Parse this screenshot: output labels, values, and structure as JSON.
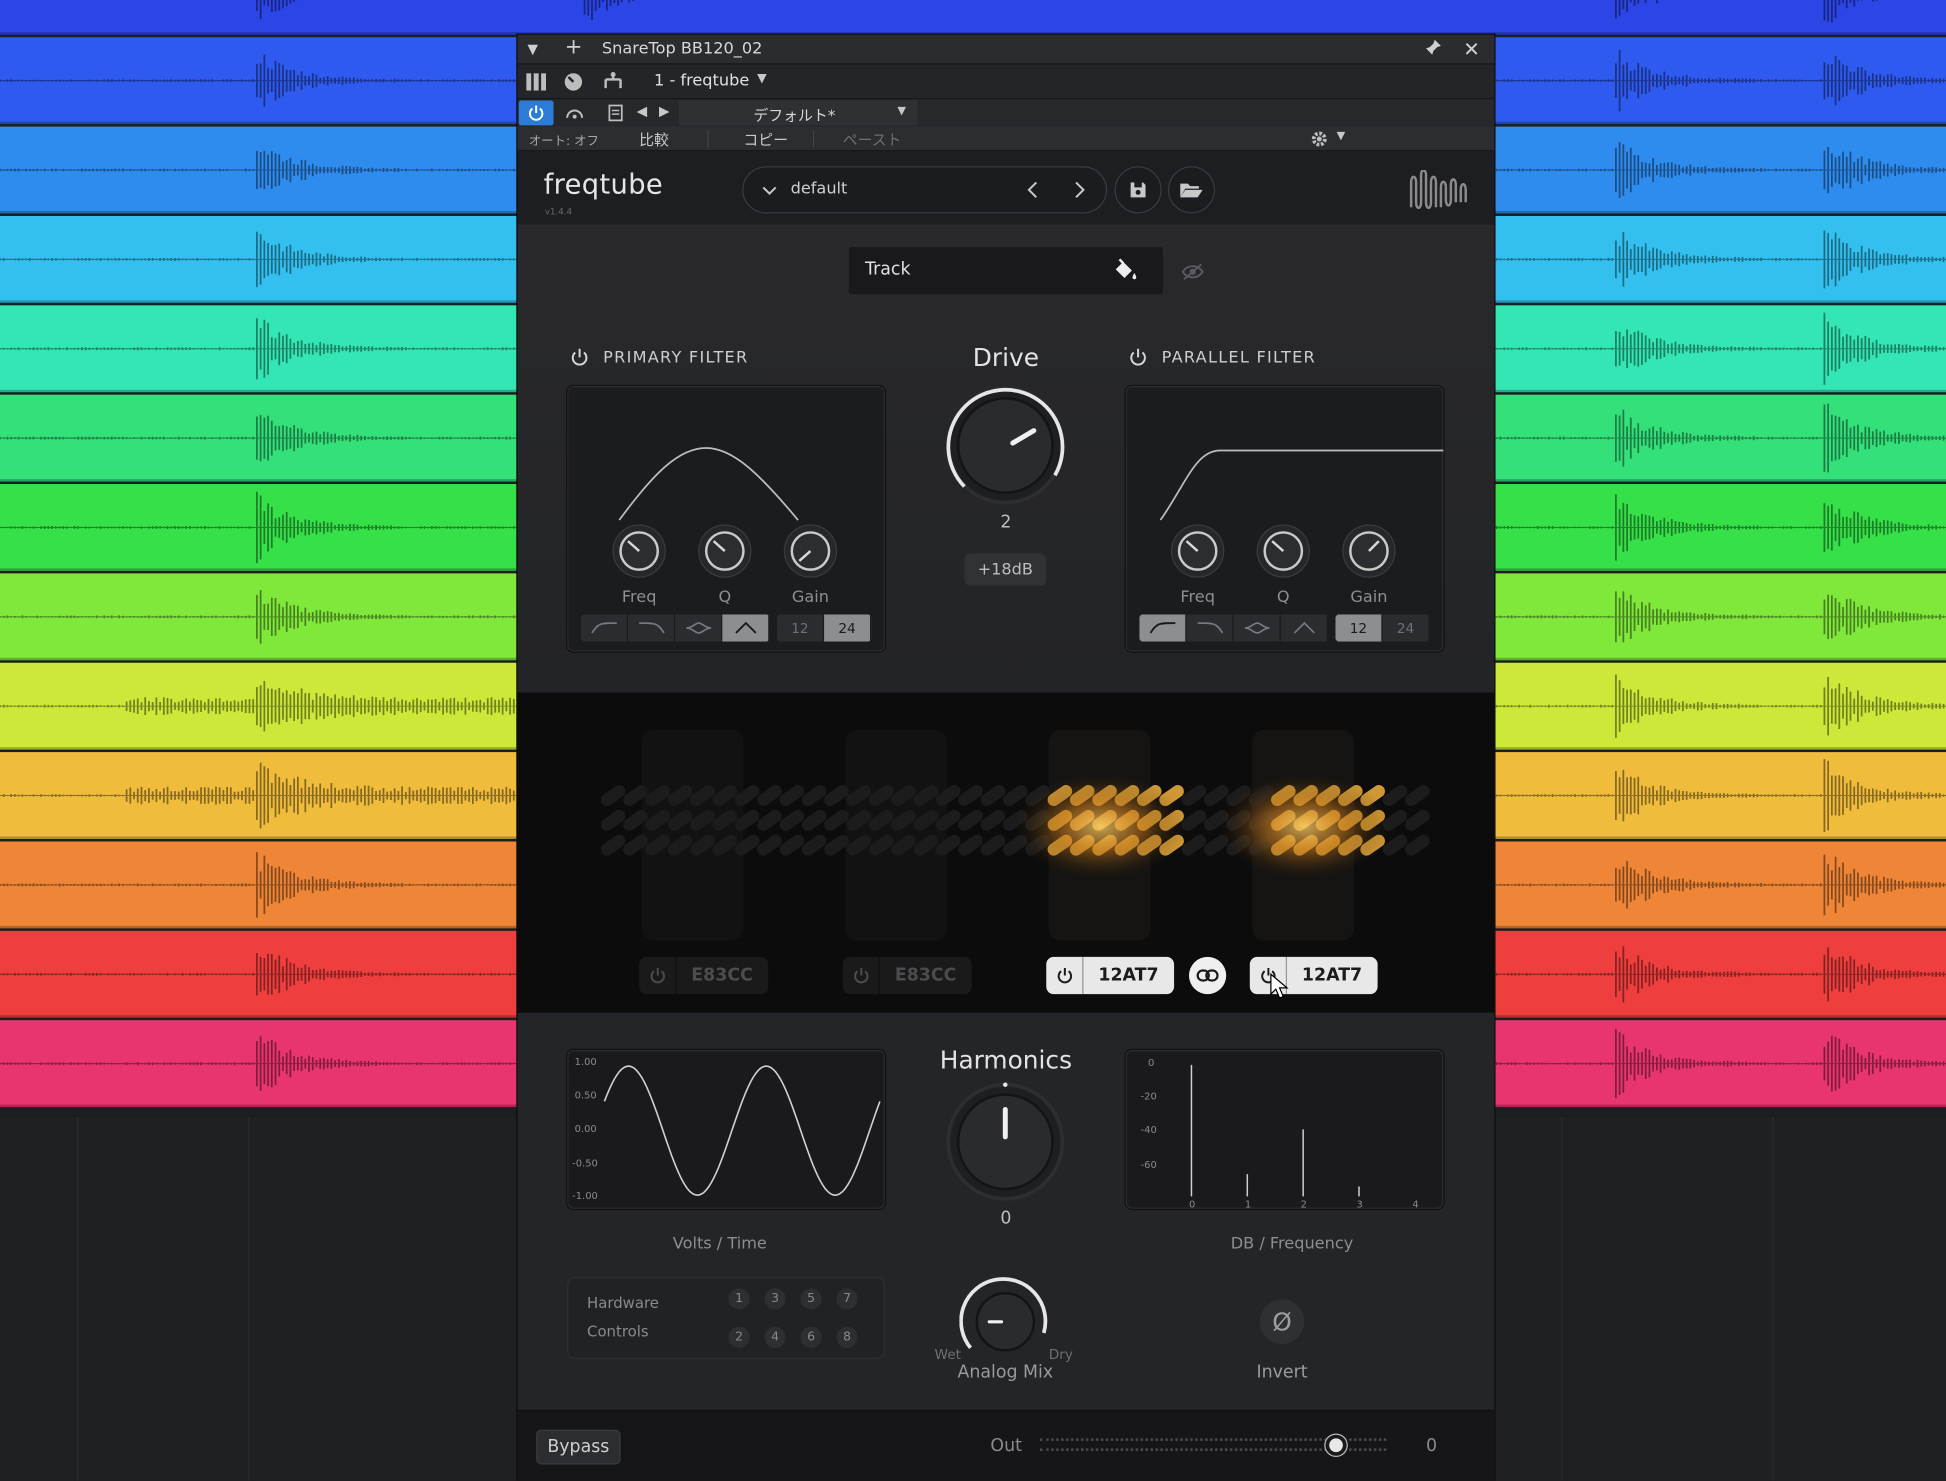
{
  "window": {
    "title": "SnareTop BB120_02",
    "plugin_slot": "1 - freqtube",
    "preset_host": "デフォルト*",
    "auto_label": "オート: オフ",
    "compare_label": "比較",
    "copy_label": "コピー",
    "paste_label": "ペースト"
  },
  "plugin": {
    "name": "freqtube",
    "version": "v1.4.4",
    "preset": "default",
    "track_label": "Track",
    "primary_filter": {
      "title": "PRIMARY FILTER",
      "knobs": [
        "Freq",
        "Q",
        "Gain"
      ],
      "slopes": [
        "12",
        "24"
      ],
      "active_shape": "bell",
      "active_slope": "24"
    },
    "drive": {
      "title": "Drive",
      "value": "2",
      "range_label": "+18dB"
    },
    "parallel_filter": {
      "title": "PARALLEL FILTER",
      "knobs": [
        "Freq",
        "Q",
        "Gain"
      ],
      "slopes": [
        "12",
        "24"
      ],
      "active_shape": "highpass",
      "active_slope": "12"
    },
    "tubes": [
      {
        "name": "E83CC",
        "enabled": false
      },
      {
        "name": "E83CC",
        "enabled": false
      },
      {
        "name": "12AT7",
        "enabled": true
      },
      {
        "name": "12AT7",
        "enabled": true
      }
    ],
    "harmonics": {
      "title": "Harmonics",
      "value": "0"
    },
    "volts_scope": {
      "caption": "Volts / Time",
      "ticks": [
        "1.00",
        "0.50",
        "0.00",
        "-0.50",
        "-1.00"
      ]
    },
    "db_scope": {
      "caption": "DB / Frequency",
      "yticks": [
        "0",
        "-20",
        "-40",
        "-60"
      ],
      "xticks": [
        "0",
        "1",
        "2",
        "3",
        "4"
      ]
    },
    "hardware_controls": {
      "label1": "Hardware",
      "label2": "Controls",
      "top": [
        "1",
        "3",
        "5",
        "7"
      ],
      "bottom": [
        "2",
        "4",
        "6",
        "8"
      ]
    },
    "analog_mix": {
      "title": "Analog Mix",
      "wet": "Wet",
      "dry": "Dry"
    },
    "invert": {
      "title": "Invert",
      "symbol": "Ø"
    },
    "footer": {
      "bypass": "Bypass",
      "out_label": "Out",
      "out_value": "0"
    }
  },
  "lane_colors": [
    "#2b45e6",
    "#2f5af0",
    "#2f8cef",
    "#33c0ef",
    "#33e6b4",
    "#33e07a",
    "#36e048",
    "#80e83a",
    "#cde838",
    "#f0bc3c",
    "#ef8536",
    "#ef3e3e",
    "#e8356e"
  ]
}
